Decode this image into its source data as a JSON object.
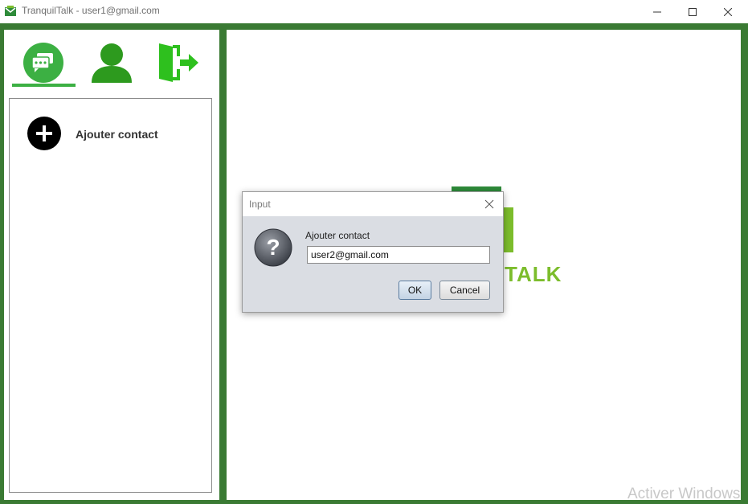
{
  "window": {
    "title": "TranquilTalk - user1@gmail.com",
    "controls": [
      "minimize",
      "maximize",
      "close"
    ]
  },
  "colors": {
    "frame_green": "#3a7a33",
    "accent_green": "#3cb043",
    "logo_green": "#7cbd2c"
  },
  "nav": {
    "items": [
      {
        "name": "chats",
        "icon": "chat-bubbles-icon",
        "active": true
      },
      {
        "name": "profile",
        "icon": "user-icon",
        "active": false
      },
      {
        "name": "logout",
        "icon": "logout-door-icon",
        "active": false
      }
    ]
  },
  "contacts": {
    "add_label": "Ajouter contact",
    "add_icon": "plus-circle-icon"
  },
  "logo": {
    "text": "TALK"
  },
  "dialog": {
    "title": "Input",
    "prompt": "Ajouter contact",
    "input_value": "user2@gmail.com",
    "ok_label": "OK",
    "cancel_label": "Cancel",
    "icon": "question-icon"
  },
  "watermark": "Activer Windows"
}
